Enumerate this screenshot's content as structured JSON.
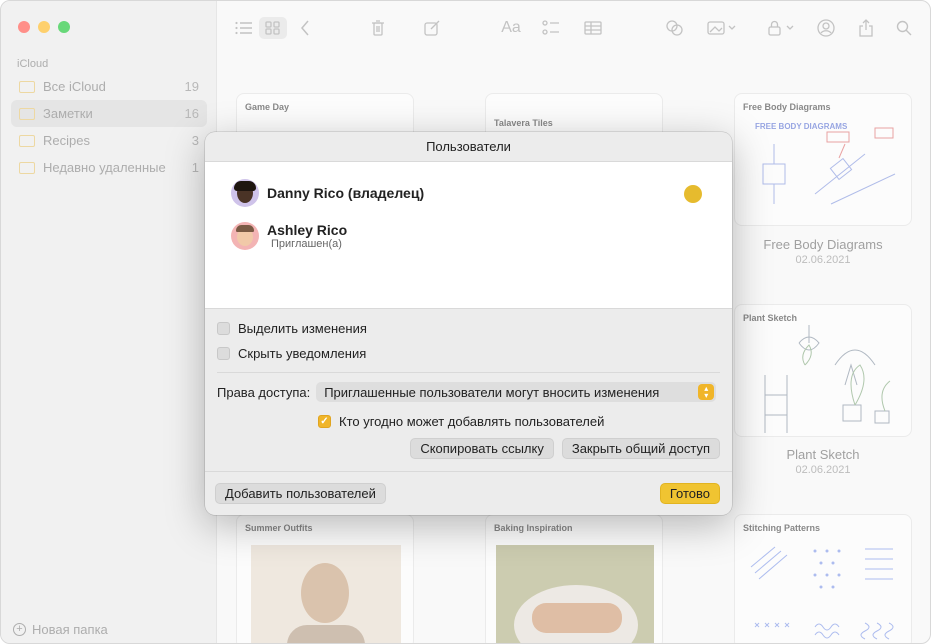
{
  "sidebar": {
    "section": "iCloud",
    "items": [
      {
        "label": "Все iCloud",
        "count": "19"
      },
      {
        "label": "Заметки",
        "count": "16"
      },
      {
        "label": "Recipes",
        "count": "3"
      },
      {
        "label": "Недавно удаленные",
        "count": "1"
      }
    ],
    "new_folder": "Новая папка"
  },
  "notes": {
    "cards": [
      {
        "title": "Game Day"
      },
      {
        "title": "Talavera Tiles"
      },
      {
        "title": "Free Body Diagrams",
        "name": "Free Body Diagrams",
        "date": "02.06.2021"
      },
      {
        "title": "Plant Sketch",
        "name": "Plant Sketch",
        "date": "02.06.2021"
      },
      {
        "title": "Summer Outfits"
      },
      {
        "title": "Baking Inspiration"
      },
      {
        "title": "Stitching Patterns"
      }
    ],
    "fbd_heading": "FREE BODY DIAGRAMS"
  },
  "dialog": {
    "title": "Пользователи",
    "people": [
      {
        "name": "Danny Rico (владелец)",
        "status": ""
      },
      {
        "name": "Ashley Rico",
        "status": "Приглашен(а)"
      }
    ],
    "highlight_changes": "Выделить изменения",
    "hide_alerts": "Скрыть уведомления",
    "access_label": "Права доступа:",
    "access_value": "Приглашенные пользователи могут вносить изменения",
    "anyone_can_add": "Кто угодно может добавлять пользователей",
    "copy_link": "Скопировать ссылку",
    "stop_sharing": "Закрыть общий доступ",
    "add_people": "Добавить пользователей",
    "done": "Готово"
  },
  "colors": {
    "accent": "#f0c431",
    "owner_dot": "#e6bb2e"
  }
}
